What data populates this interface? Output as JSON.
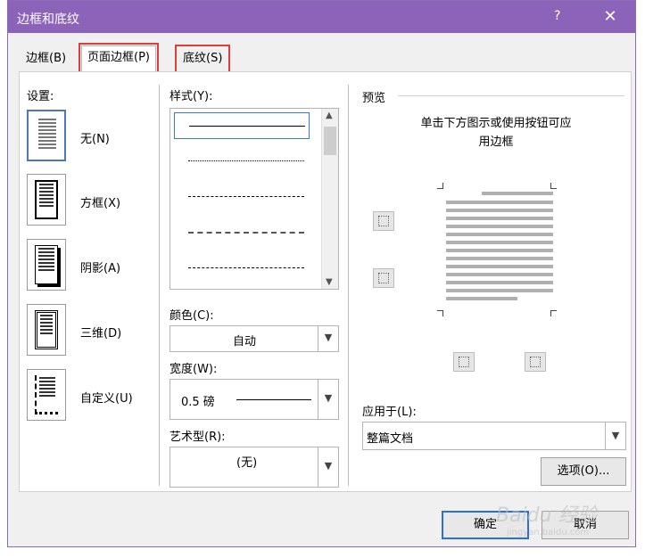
{
  "dialog": {
    "title": "边框和底纹",
    "help": "?",
    "close": "✕"
  },
  "tabs": [
    {
      "label": "边框(B)"
    },
    {
      "label": "页面边框(P)"
    },
    {
      "label": "底纹(S)"
    }
  ],
  "settings": {
    "header": "设置:",
    "items": [
      {
        "label": "无(N)"
      },
      {
        "label": "方框(X)"
      },
      {
        "label": "阴影(A)"
      },
      {
        "label": "三维(D)"
      },
      {
        "label": "自定义(U)"
      }
    ]
  },
  "style": {
    "label": "样式(Y):"
  },
  "color": {
    "label": "颜色(C):",
    "value": "自动"
  },
  "width": {
    "label": "宽度(W):",
    "value": "0.5 磅"
  },
  "art": {
    "label": "艺术型(R):",
    "value": "(无)"
  },
  "preview": {
    "header": "预览",
    "hint_line1": "单击下方图示或使用按钮可应",
    "hint_line2": "用边框"
  },
  "apply_to": {
    "label": "应用于(L):",
    "value": "整篇文档"
  },
  "buttons": {
    "options": "选项(O)...",
    "ok": "确定",
    "cancel": "取消"
  },
  "watermark": {
    "text": "Baidu 经验",
    "sub": "jingyan.baidu.com"
  }
}
